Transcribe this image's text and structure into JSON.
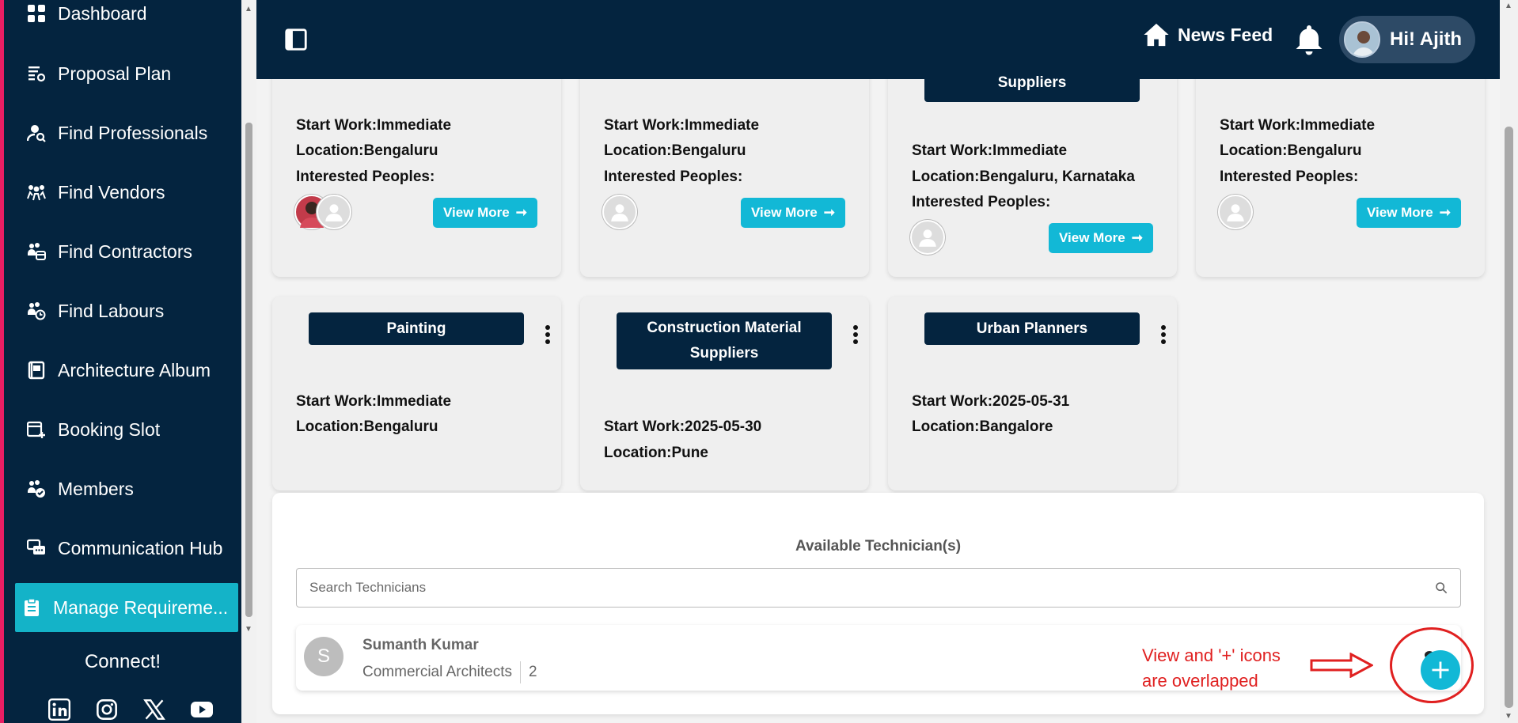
{
  "sidebar": {
    "items": [
      {
        "label": "Dashboard",
        "icon": "grid-icon"
      },
      {
        "label": "Proposal Plan",
        "icon": "list-settings-icon"
      },
      {
        "label": "Find Professionals",
        "icon": "user-search-icon"
      },
      {
        "label": "Find Vendors",
        "icon": "people-icon"
      },
      {
        "label": "Find Contractors",
        "icon": "group-icon"
      },
      {
        "label": "Find Labours",
        "icon": "group-clock-icon"
      },
      {
        "label": "Architecture Album",
        "icon": "album-icon"
      },
      {
        "label": "Booking Slot",
        "icon": "calendar-plus-icon"
      },
      {
        "label": "Members",
        "icon": "members-check-icon"
      },
      {
        "label": "Communication Hub",
        "icon": "chat-icon"
      },
      {
        "label": "Manage Requireme...",
        "icon": "clipboard-icon",
        "active": true
      }
    ],
    "connect_label": "Connect!",
    "socials": [
      "linkedin-icon",
      "instagram-icon",
      "x-icon",
      "youtube-icon"
    ]
  },
  "header": {
    "news_feed_label": "News Feed",
    "greeting": "Hi! Ajith"
  },
  "cards_row1": [
    {
      "title": "",
      "start": "Start Work:Immediate",
      "location": "Location:Bengaluru",
      "interested": "Interested Peoples:",
      "view_more": "View More"
    },
    {
      "title": "",
      "start": "Start Work:Immediate",
      "location": "Location:Bengaluru",
      "interested": "Interested Peoples:",
      "view_more": "View More"
    },
    {
      "title": "Suppliers",
      "start": "Start Work:Immediate",
      "location": "Location:Bengaluru, Karnataka",
      "interested": "Interested Peoples:",
      "view_more": "View More"
    },
    {
      "title": "",
      "start": "Start Work:Immediate",
      "location": "Location:Bengaluru",
      "interested": "Interested Peoples:",
      "view_more": "View More"
    }
  ],
  "cards_row2": [
    {
      "title": "Painting",
      "start": "Start Work:Immediate",
      "location": "Location:Bengaluru"
    },
    {
      "title_line1": "Construction Material",
      "title_line2": "Suppliers",
      "start": "Start Work:2025-05-30",
      "location": "Location:Pune"
    },
    {
      "title": "Urban Planners",
      "start": "Start Work:2025-05-31",
      "location": "Location:Bangalore"
    }
  ],
  "technicians": {
    "title": "Available Technician(s)",
    "search_placeholder": "Search Technicians",
    "rows": [
      {
        "initial": "S",
        "name": "Sumanth Kumar",
        "role": "Commercial Architects",
        "count": "2"
      }
    ]
  },
  "annotation": {
    "line1": "View and '+' icons",
    "line2": "are overlapped"
  },
  "colors": {
    "navy": "#04243f",
    "accent": "#12b8d6",
    "annotation": "#e02020"
  }
}
